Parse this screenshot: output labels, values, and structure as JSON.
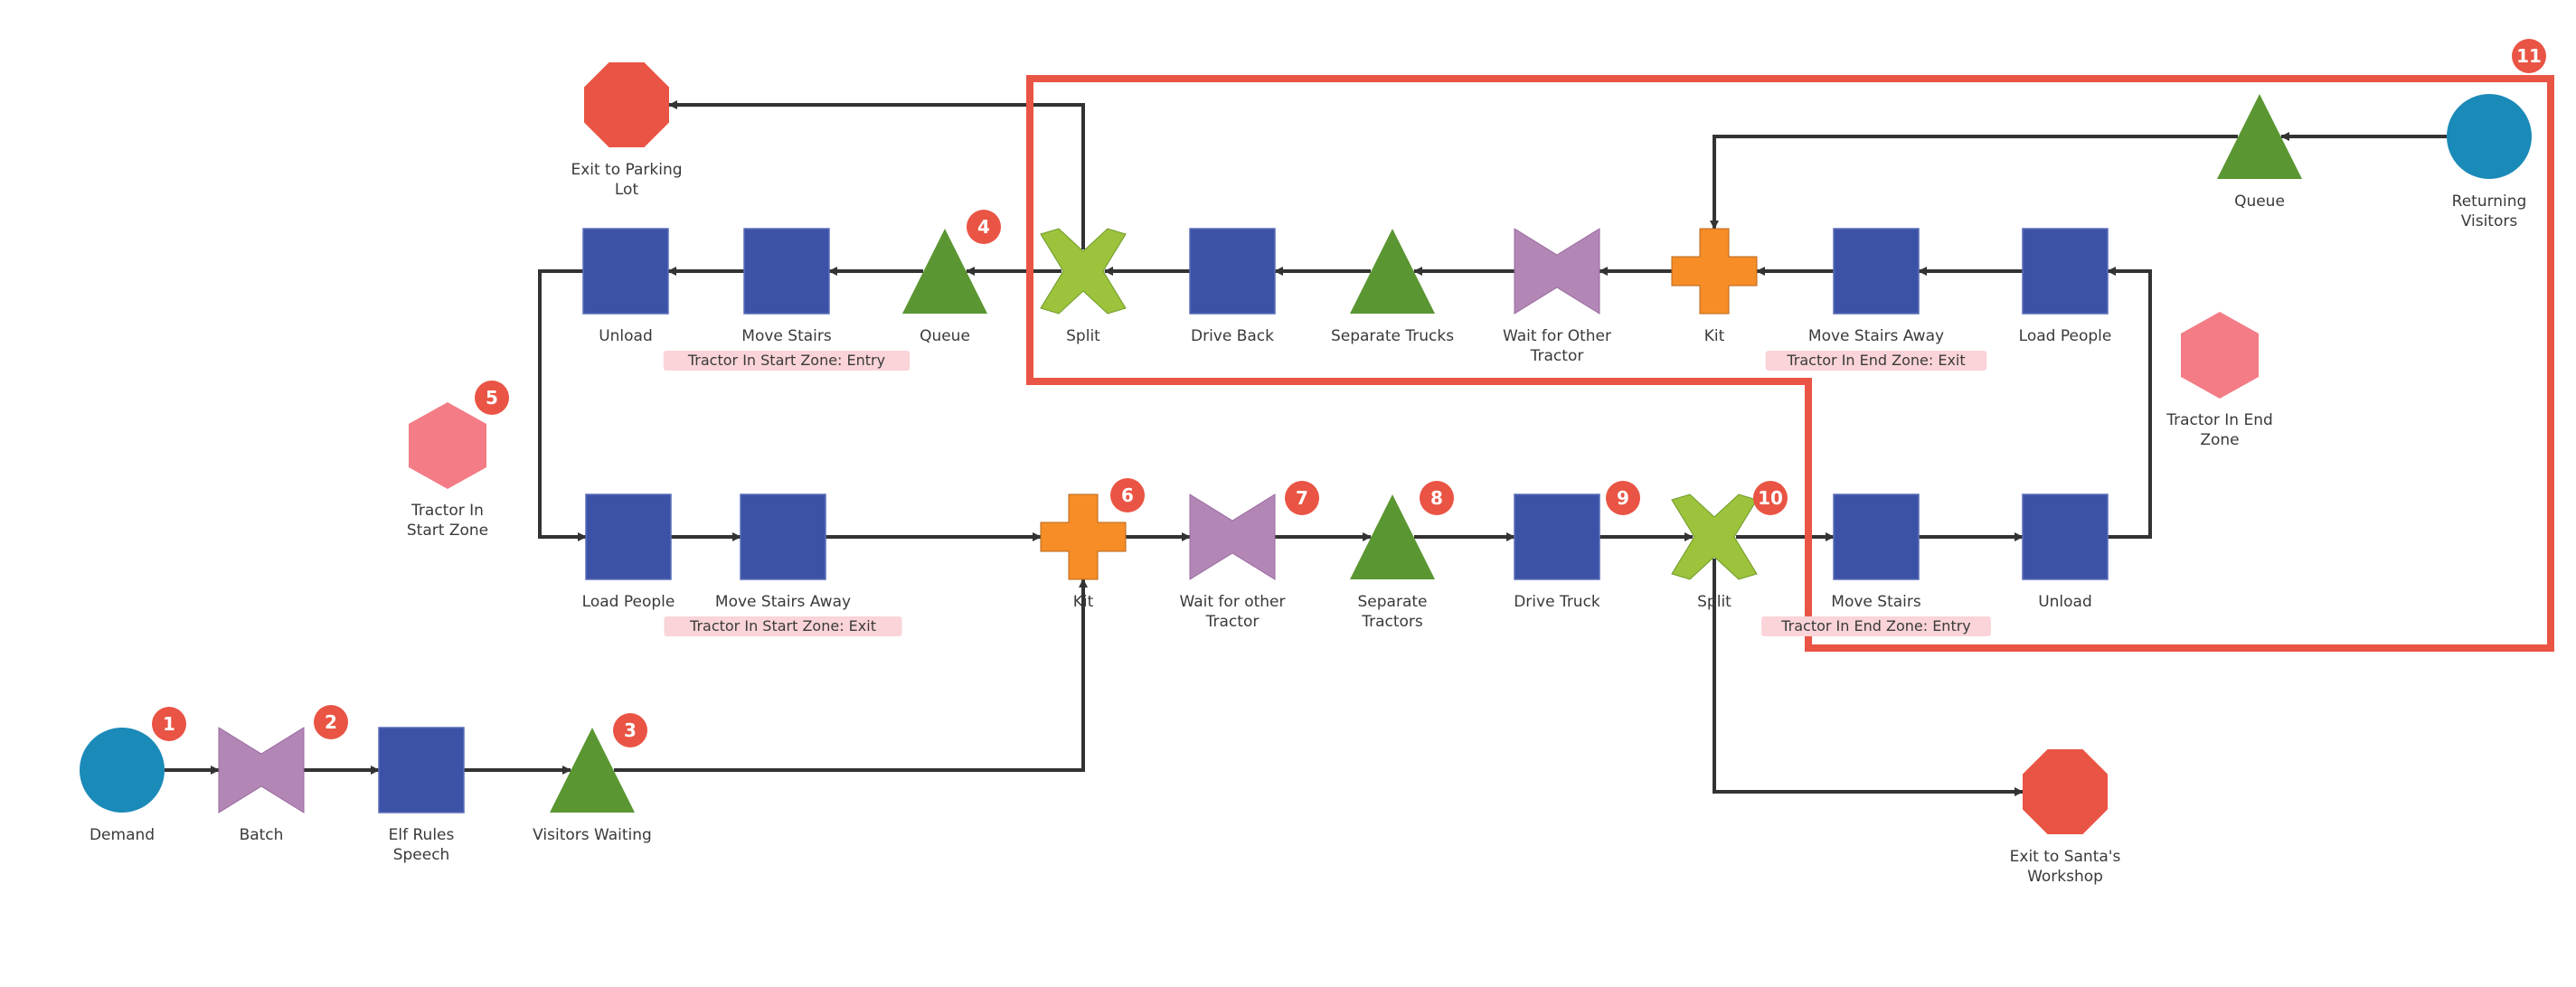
{
  "diagram": {
    "colors": {
      "process": "#3c52a6",
      "queue": "#5a9632",
      "batch": "#b287b5",
      "kit": "#f68d27",
      "split": "#9cc33b",
      "source": "#1a8ab8",
      "exit": "#e95444",
      "resource": "#f37c86",
      "highlight": "#e95444",
      "badge": "#e95444",
      "tag_bg": "#fad4d8",
      "connector": "#333333"
    },
    "nodes": [
      {
        "id": "demand",
        "type": "source",
        "label": [
          "Demand"
        ]
      },
      {
        "id": "batch",
        "type": "batch",
        "label": [
          "Batch"
        ]
      },
      {
        "id": "elf-rules-speech",
        "type": "process",
        "label": [
          "Elf Rules",
          "Speech"
        ]
      },
      {
        "id": "visitors-waiting",
        "type": "queue",
        "label": [
          "Visitors Waiting"
        ]
      },
      {
        "id": "kit-out",
        "type": "kit",
        "label": [
          "Kit"
        ]
      },
      {
        "id": "wait-other-tractor-out",
        "type": "batch",
        "label": [
          "Wait for other",
          "Tractor"
        ]
      },
      {
        "id": "separate-tractors",
        "type": "queue",
        "label": [
          "Separate",
          "Tractors"
        ]
      },
      {
        "id": "drive-truck",
        "type": "process",
        "label": [
          "Drive Truck"
        ]
      },
      {
        "id": "split-out",
        "type": "split",
        "label": [
          "Split"
        ]
      },
      {
        "id": "move-stairs-end",
        "type": "process",
        "label": [
          "Move Stairs"
        ],
        "tag": "Tractor In End Zone: Entry"
      },
      {
        "id": "unload-end",
        "type": "process",
        "label": [
          "Unload"
        ]
      },
      {
        "id": "load-people-end",
        "type": "process",
        "label": [
          "Load People"
        ]
      },
      {
        "id": "move-stairs-away-end",
        "type": "process",
        "label": [
          "Move Stairs Away"
        ],
        "tag": "Tractor In End Zone: Exit"
      },
      {
        "id": "kit-back",
        "type": "kit",
        "label": [
          "Kit"
        ]
      },
      {
        "id": "wait-other-tractor-back",
        "type": "batch",
        "label": [
          "Wait for Other",
          "Tractor"
        ]
      },
      {
        "id": "separate-trucks",
        "type": "queue",
        "label": [
          "Separate Trucks"
        ]
      },
      {
        "id": "drive-back",
        "type": "process",
        "label": [
          "Drive Back"
        ]
      },
      {
        "id": "split-back",
        "type": "split",
        "label": [
          "Split"
        ]
      },
      {
        "id": "queue-start",
        "type": "queue",
        "label": [
          "Queue"
        ]
      },
      {
        "id": "move-stairs-start",
        "type": "process",
        "label": [
          "Move Stairs"
        ],
        "tag": "Tractor In Start Zone: Entry"
      },
      {
        "id": "unload-start",
        "type": "process",
        "label": [
          "Unload"
        ]
      },
      {
        "id": "load-people-start",
        "type": "process",
        "label": [
          "Load People"
        ]
      },
      {
        "id": "move-stairs-away-start",
        "type": "process",
        "label": [
          "Move Stairs Away"
        ],
        "tag": "Tractor In Start Zone: Exit"
      },
      {
        "id": "exit-parking-lot",
        "type": "exit",
        "label": [
          "Exit to Parking",
          "Lot"
        ]
      },
      {
        "id": "exit-santas-workshop",
        "type": "exit",
        "label": [
          "Exit to Santa's",
          "Workshop"
        ]
      },
      {
        "id": "returning-visitors",
        "type": "source",
        "label": [
          "Returning",
          "Visitors"
        ]
      },
      {
        "id": "queue-returning",
        "type": "queue",
        "label": [
          "Queue"
        ]
      },
      {
        "id": "tractor-in-start-zone",
        "type": "resource",
        "label": [
          "Tractor In",
          "Start Zone"
        ]
      },
      {
        "id": "tractor-in-end-zone",
        "type": "resource",
        "label": [
          "Tractor In End",
          "Zone"
        ]
      }
    ],
    "edges": [
      [
        "demand",
        "batch"
      ],
      [
        "batch",
        "elf-rules-speech"
      ],
      [
        "elf-rules-speech",
        "visitors-waiting"
      ],
      [
        "visitors-waiting",
        "kit-out"
      ],
      [
        "load-people-start",
        "move-stairs-away-start"
      ],
      [
        "move-stairs-away-start",
        "kit-out"
      ],
      [
        "kit-out",
        "wait-other-tractor-out"
      ],
      [
        "wait-other-tractor-out",
        "separate-tractors"
      ],
      [
        "separate-tractors",
        "drive-truck"
      ],
      [
        "drive-truck",
        "split-out"
      ],
      [
        "split-out",
        "move-stairs-end"
      ],
      [
        "split-out",
        "exit-santas-workshop"
      ],
      [
        "move-stairs-end",
        "unload-end"
      ],
      [
        "unload-end",
        "load-people-end"
      ],
      [
        "load-people-end",
        "move-stairs-away-end"
      ],
      [
        "move-stairs-away-end",
        "kit-back"
      ],
      [
        "returning-visitors",
        "queue-returning"
      ],
      [
        "queue-returning",
        "kit-back"
      ],
      [
        "kit-back",
        "wait-other-tractor-back"
      ],
      [
        "wait-other-tractor-back",
        "separate-trucks"
      ],
      [
        "separate-trucks",
        "drive-back"
      ],
      [
        "drive-back",
        "split-back"
      ],
      [
        "split-back",
        "queue-start"
      ],
      [
        "split-back",
        "exit-parking-lot"
      ],
      [
        "queue-start",
        "move-stairs-start"
      ],
      [
        "move-stairs-start",
        "unload-start"
      ],
      [
        "unload-start",
        "load-people-start"
      ]
    ],
    "badges": [
      {
        "text": "1",
        "near": "demand"
      },
      {
        "text": "2",
        "near": "batch"
      },
      {
        "text": "3",
        "near": "visitors-waiting"
      },
      {
        "text": "4",
        "near": "queue-start"
      },
      {
        "text": "5",
        "near": "tractor-in-start-zone"
      },
      {
        "text": "6",
        "near": "kit-out"
      },
      {
        "text": "7",
        "near": "wait-other-tractor-out"
      },
      {
        "text": "8",
        "near": "separate-tractors"
      },
      {
        "text": "9",
        "near": "drive-truck"
      },
      {
        "text": "10",
        "near": "split-out"
      },
      {
        "text": "11",
        "near": "highlight-region"
      }
    ],
    "highlight_region": {
      "label": "11",
      "contains": [
        "split-back",
        "drive-back",
        "separate-trucks",
        "wait-other-tractor-back",
        "kit-back",
        "move-stairs-away-end",
        "load-people-end",
        "queue-returning",
        "returning-visitors",
        "tractor-in-end-zone",
        "move-stairs-end",
        "unload-end"
      ]
    }
  }
}
